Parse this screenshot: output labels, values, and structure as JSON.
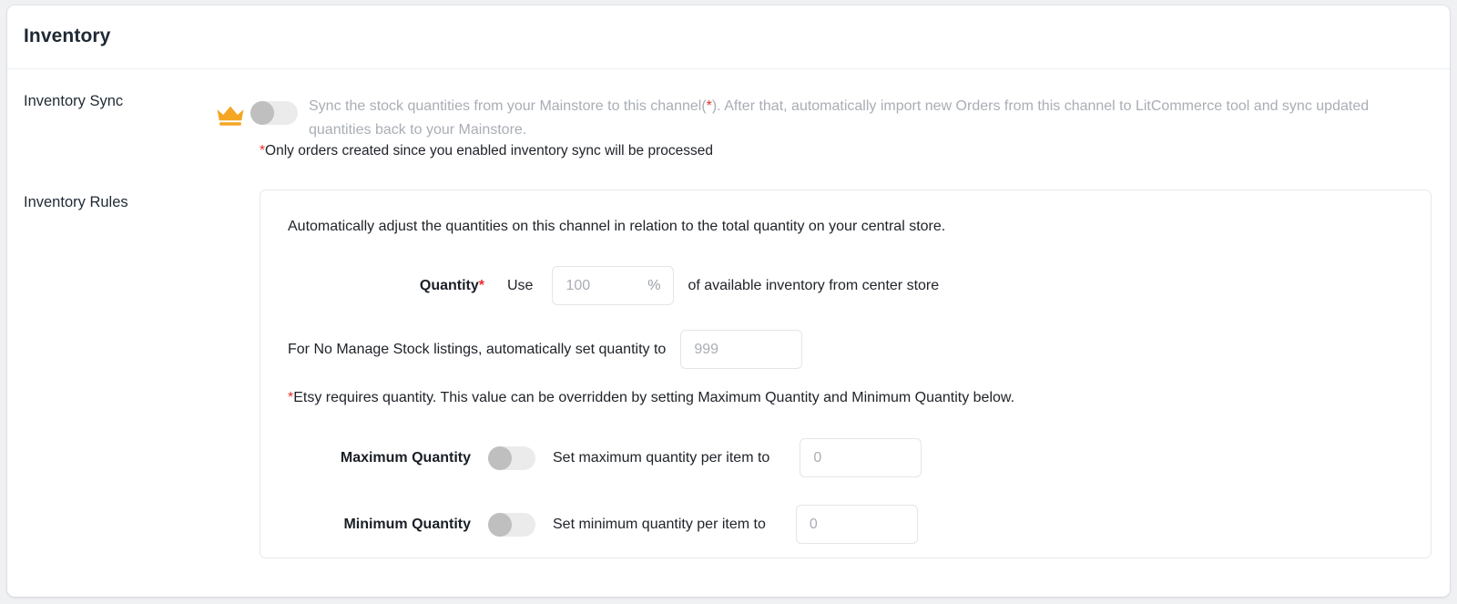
{
  "panel": {
    "title": "Inventory"
  },
  "inventory_sync": {
    "label": "Inventory Sync",
    "badge_icon": "crown-icon",
    "toggle_state": "off",
    "description_part1": "Sync the stock quantities from your Mainstore to this channel(",
    "description_asterisk": "*",
    "description_part2": "). After that, automatically import new Orders from this channel to LitCommerce tool and sync updated quantities back to your Mainstore.",
    "note_asterisk": "*",
    "note": "Only orders created since you enabled inventory sync will be processed"
  },
  "inventory_rules": {
    "label": "Inventory Rules",
    "intro": "Automatically adjust the quantities on this channel in relation to the total quantity on your central store.",
    "quantity": {
      "label": "Quantity",
      "required_mark": "*",
      "use_word": "Use",
      "input_placeholder": "100",
      "input_value": "",
      "unit": "%",
      "suffix_text": "of available inventory from center store"
    },
    "no_manage_stock": {
      "text": "For No Manage Stock listings, automatically set quantity to",
      "input_placeholder": "999",
      "input_value": ""
    },
    "etsy_note_asterisk": "*",
    "etsy_note": "Etsy requires quantity. This value can be overridden by setting Maximum Quantity and Minimum Quantity below.",
    "maximum_quantity": {
      "label": "Maximum Quantity",
      "toggle_state": "off",
      "text": "Set maximum quantity per item to",
      "input_placeholder": "0",
      "input_value": ""
    },
    "minimum_quantity": {
      "label": "Minimum Quantity",
      "toggle_state": "off",
      "text": "Set minimum quantity per item to",
      "input_placeholder": "0",
      "input_value": ""
    }
  },
  "colors": {
    "crown": "#F5A623",
    "required_red": "#ee2b2b",
    "muted_text": "#a9aeb5",
    "body_text": "#20242a",
    "toggle_track_off": "#ebebeb",
    "toggle_knob_off": "#bfbfbf",
    "card_border": "#e7e9ec",
    "page_bg": "#f0f1f3"
  }
}
